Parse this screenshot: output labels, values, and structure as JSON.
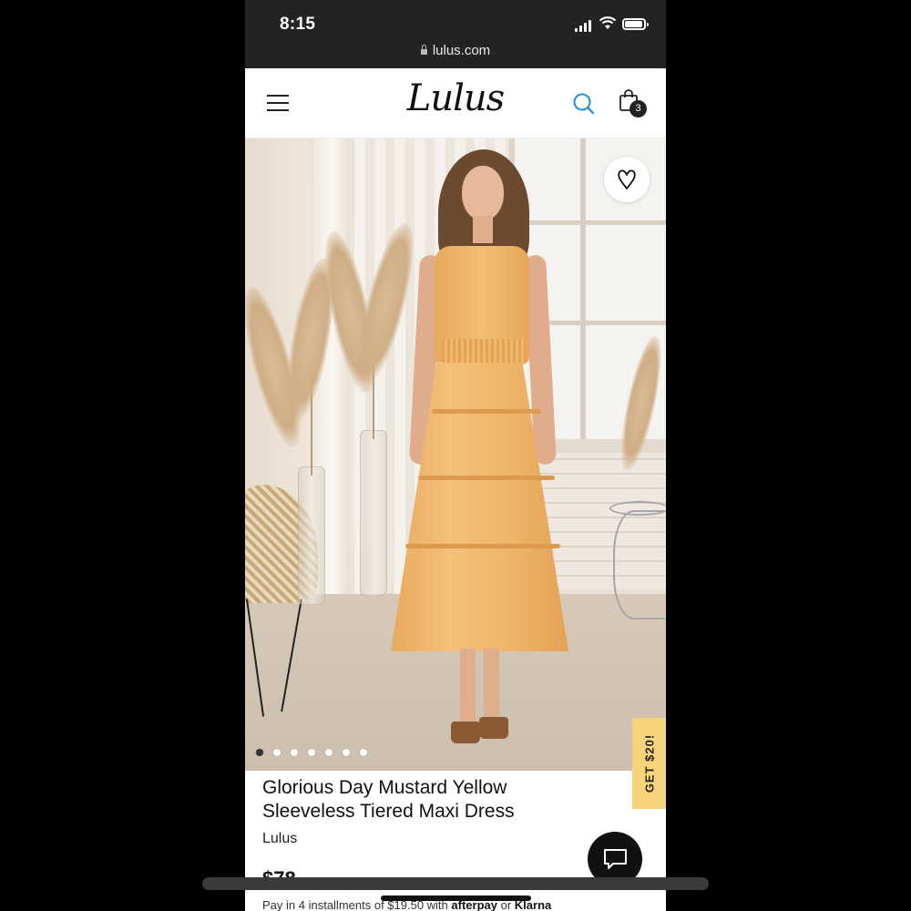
{
  "status": {
    "time": "8:15"
  },
  "browser": {
    "url": "lulus.com"
  },
  "header": {
    "logo": "Lulus",
    "bag_count": "3"
  },
  "product": {
    "title": "Glorious Day Mustard Yellow Sleeveless Tiered Maxi Dress",
    "brand": "Lulus",
    "price": "$78",
    "installments_text": "Pay in 4 installments of $19.50 with",
    "afterpay": "afterpay",
    "or": "or",
    "klarna": "Klarna"
  },
  "gallery": {
    "total": 7,
    "active": 0
  },
  "promo": {
    "label": "GET $20!"
  },
  "icons": [
    "menu-icon",
    "search-icon",
    "bag-icon",
    "heart-icon",
    "chat-icon",
    "lock-icon"
  ],
  "colors": {
    "accent_search": "#1e8fd6",
    "promo_bg": "#f7d47a",
    "dress": "#f0b86b"
  }
}
